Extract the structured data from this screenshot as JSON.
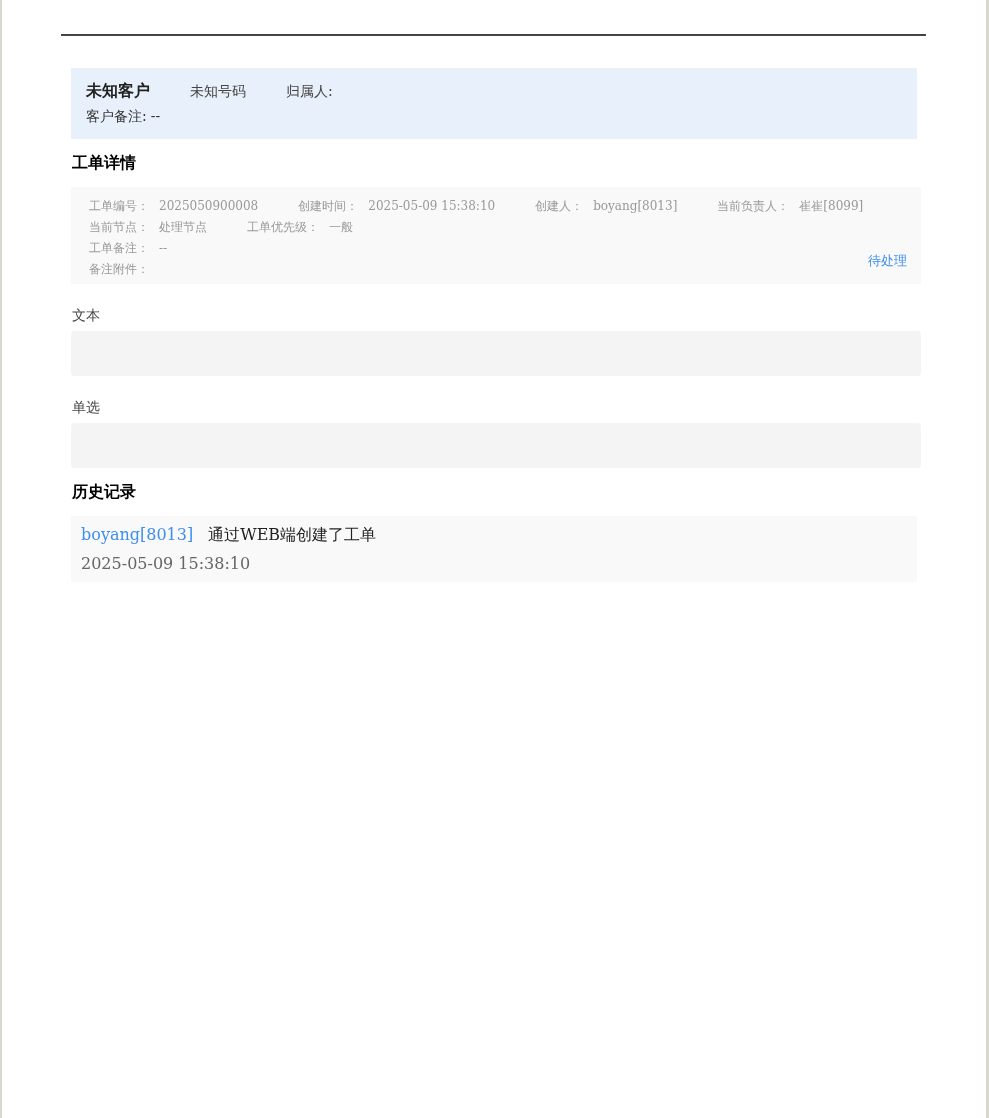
{
  "customer": {
    "name": "未知客户",
    "phone": "未知号码",
    "owner_label": "归属人:",
    "remark_label": "客户备注:",
    "remark_value": "--"
  },
  "detail": {
    "title": "工单详情",
    "rows": [
      [
        {
          "label": "工单编号：",
          "value": "2025050900008"
        },
        {
          "label": "创建时间：",
          "value": "2025-05-09 15:38:10"
        },
        {
          "label": "创建人：",
          "value": "boyang[8013]"
        },
        {
          "label": "当前负责人：",
          "value": "崔崔[8099]"
        }
      ],
      [
        {
          "label": "当前节点：",
          "value": "处理节点"
        },
        {
          "label": "工单优先级：",
          "value": "一般"
        }
      ],
      [
        {
          "label": "工单备注：",
          "value": "--"
        }
      ],
      [
        {
          "label": "备注附件："
        }
      ]
    ],
    "status": "待处理"
  },
  "fields": [
    {
      "label": "文本"
    },
    {
      "label": "单选"
    }
  ],
  "history": {
    "title": "历史记录",
    "entries": [
      {
        "user": "boyang[8013]",
        "action": "通过WEB端创建了工单",
        "time": "2025-05-09 15:38:10"
      }
    ]
  }
}
